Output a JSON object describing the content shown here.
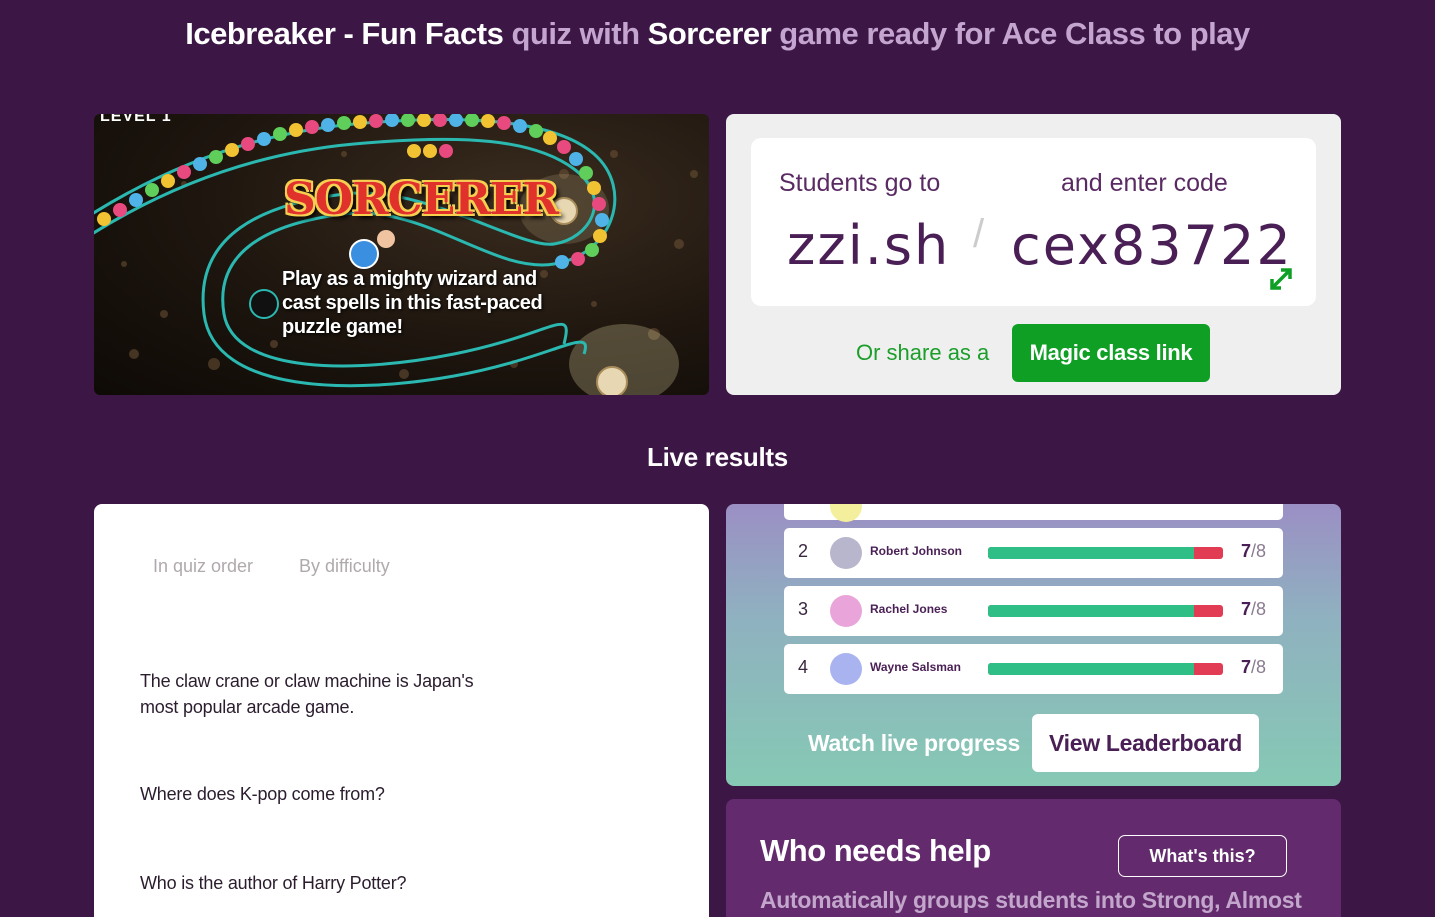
{
  "header": {
    "quiz_name": "Icebreaker - Fun Facts",
    "mid1": " quiz with ",
    "game_name": "Sorcerer",
    "mid2": " game ready for Ace Class to play"
  },
  "game": {
    "level_label": "LEVEL 1",
    "logo_text": "SORCERER",
    "description": "Play as a mighty wizard and cast spells in this fast-paced puzzle game!"
  },
  "join": {
    "go_label": "Students go to",
    "enter_label": "and enter code",
    "site": "zzi.sh",
    "separator": "/",
    "code": "cex83722",
    "share_text": "Or share as a",
    "magic_link_label": "Magic class link",
    "expand_icon": "expand-arrows-icon"
  },
  "live": {
    "title": "Live results"
  },
  "questions": {
    "tabs": [
      "In quiz order",
      "By difficulty"
    ],
    "items": [
      "The claw crane or claw machine is Japan's most popular arcade game.",
      "Where does K-pop come from?",
      "Who is the author of Harry Potter?"
    ]
  },
  "leaderboard": {
    "rows": [
      {
        "rank": "2",
        "name": "Robert Johnson",
        "score": "7",
        "total": "/8",
        "progress": 0.875,
        "avatar_color": "#b8b6cc"
      },
      {
        "rank": "3",
        "name": "Rachel Jones",
        "score": "7",
        "total": "/8",
        "progress": 0.875,
        "avatar_color": "#e9a5d9"
      },
      {
        "rank": "4",
        "name": "Wayne Salsman",
        "score": "7",
        "total": "/8",
        "progress": 0.875,
        "avatar_color": "#a9b3ef"
      }
    ],
    "watch_label": "Watch live progress",
    "view_button": "View Leaderboard"
  },
  "help": {
    "title": "Who needs help",
    "whats_this": "What's this?",
    "description": "Automatically groups students into Strong, Almost"
  },
  "colors": {
    "background": "#3c1746",
    "accent_green": "#0f9f25",
    "progress_green": "#2ebe86",
    "progress_red": "#e23c54"
  }
}
